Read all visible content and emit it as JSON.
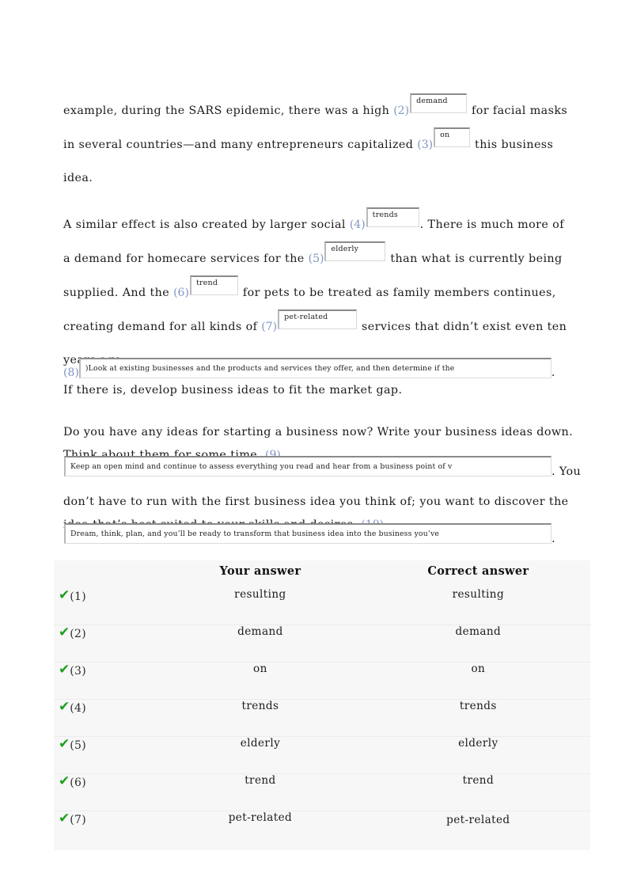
{
  "passage": {
    "paragraph1": {
      "before_2": "example, during the SARS epidemic, there was a high ",
      "label_2": "(2)",
      "field_2_value": "demand",
      "between_2_3": " for facial masks in several countries—and many entrepreneurs capitalized ",
      "label_3": "(3)",
      "field_3_value": "on",
      "after_3": " this business idea."
    },
    "paragraph2": {
      "before_4": "A similar effect is also created by larger social ",
      "label_4": "(4)",
      "field_4_value": "trends",
      "between_4_5": ". There is much more of a demand for homecare services for the ",
      "label_5": "(5)",
      "field_5_value": "elderly",
      "between_5_6": " than what is currently being supplied. And the ",
      "label_6": "(6)",
      "field_6_value": "trend",
      "between_6_7": " for pets to be treated as family members continues, creating demand for all kinds of ",
      "label_7": "(7)",
      "field_7_value": "pet-related",
      "after_7": " services that didn’t exist even ten years ago."
    },
    "row8": {
      "label_8": "(8)",
      "field_8_value": ")Look at existing businesses and the products and services they offer, and then determine if the",
      "tail": "."
    },
    "line_if_there": "If there is, develop business ideas to fit the market gap.",
    "block_ideas": "Do you have any ideas for starting a business now? Write your business ideas down. Think about them for some time. ",
    "label_9": "(9)",
    "row9": {
      "field_9_value": "Keep an open mind and continue to assess everything you read and hear from a business point of v",
      "tail": ". You"
    },
    "block_dont": "don’t have to run with the first business idea you think of; you want to discover the idea that’s best suited to your skills and desires. ",
    "label_10": "(10)",
    "row10": {
      "field_10_value": "Dream, think, plan, and you’ll be ready to transform that business idea into the business you’ve",
      "tail": "."
    }
  },
  "results_table": {
    "headers": {
      "mark": "",
      "number": "",
      "your_answer": "Your answer",
      "correct_answer": "Correct answer"
    },
    "mark_icon": "✔",
    "mark_color": "#1da01d",
    "rows": [
      {
        "mark": "✔",
        "open": "(1",
        "close": ")",
        "your_answer": "resulting",
        "correct_answer": "resulting"
      },
      {
        "mark": "✔",
        "open": "(2",
        "close": ")",
        "your_answer": "demand",
        "correct_answer": "demand"
      },
      {
        "mark": "✔",
        "open": "(3",
        "close": ")",
        "your_answer": "on",
        "correct_answer": "on"
      },
      {
        "mark": "✔",
        "open": "(4",
        "close": ")",
        "your_answer": "trends",
        "correct_answer": "trends"
      },
      {
        "mark": "✔",
        "open": "(5",
        "close": ")",
        "your_answer": "elderly",
        "correct_answer": "elderly"
      },
      {
        "mark": "✔",
        "open": "(6",
        "close": ")",
        "your_answer": "trend",
        "correct_answer": "trend"
      },
      {
        "mark": "✔",
        "open": "(7",
        "close": ")",
        "your_answer": "pet-related",
        "correct_answer": "pet-related"
      }
    ]
  },
  "colors": {
    "blank_label": "#7f95c4",
    "check_green": "#1da01d",
    "table_background": "#f7f7f7",
    "text": "#1c1c1c"
  }
}
